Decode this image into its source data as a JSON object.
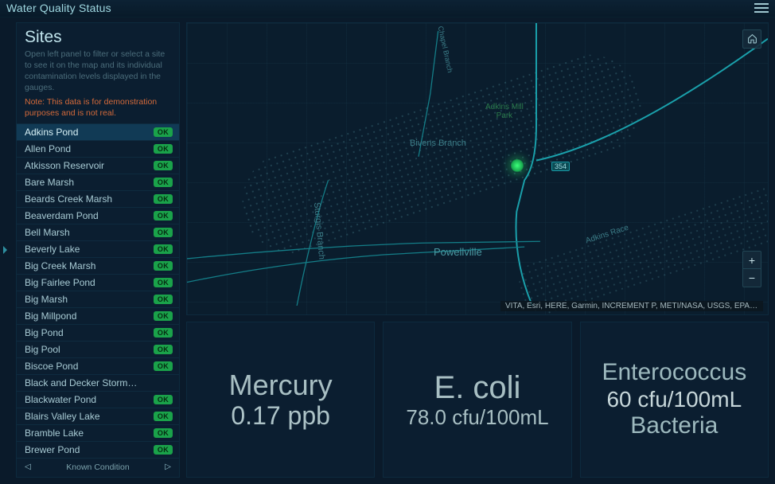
{
  "header": {
    "title": "Water Quality Status"
  },
  "sidebar": {
    "title": "Sites",
    "desc": "Open left panel to filter or select a site to see it on the map and its individual contamination levels displayed in the gauges.",
    "warn": "Note: This data is for demonstration purposes and is not real.",
    "pager_label": "Known Condition",
    "items": [
      {
        "label": "Adkins Pond",
        "status": "OK",
        "selected": true
      },
      {
        "label": "Allen Pond",
        "status": "OK"
      },
      {
        "label": "Atkisson Reservoir",
        "status": "OK"
      },
      {
        "label": "Bare Marsh",
        "status": "OK"
      },
      {
        "label": "Beards Creek Marsh",
        "status": "OK"
      },
      {
        "label": "Beaverdam Pond",
        "status": "OK"
      },
      {
        "label": "Bell Marsh",
        "status": "OK"
      },
      {
        "label": "Beverly Lake",
        "status": "OK"
      },
      {
        "label": "Big Creek Marsh",
        "status": "OK"
      },
      {
        "label": "Big Fairlee Pond",
        "status": "OK"
      },
      {
        "label": "Big Marsh",
        "status": "OK"
      },
      {
        "label": "Big Millpond",
        "status": "OK"
      },
      {
        "label": "Big Pond",
        "status": "OK"
      },
      {
        "label": "Big Pool",
        "status": "OK"
      },
      {
        "label": "Biscoe Pond",
        "status": "OK"
      },
      {
        "label": "Black and Decker Stormwater Pond",
        "status": ""
      },
      {
        "label": "Blackwater Pond",
        "status": "OK"
      },
      {
        "label": "Blairs Valley Lake",
        "status": "OK"
      },
      {
        "label": "Bramble Lake",
        "status": "OK"
      },
      {
        "label": "Brewer Pond",
        "status": "OK"
      }
    ]
  },
  "map": {
    "city_label": "Powellville",
    "park_label_l1": "Adkins Mill",
    "park_label_l2": "Park",
    "branch1": "Bivens Branch",
    "branch2": "Sturgis Branch",
    "chapel": "Chapel Branch",
    "race": "Adkins Race",
    "hwy": "354",
    "attribution": "VITA, Esri, HERE, Garmin, INCREMENT P, METI/NASA, USGS, EPA, NPS,…"
  },
  "cards": {
    "mercury": {
      "title": "Mercury",
      "value": "0.17 ppb"
    },
    "ecoli": {
      "title": "E. coli",
      "value": "78.0 cfu/100mL"
    },
    "entero": {
      "title": "Enterococcus",
      "value": "60 cfu/100mL",
      "sub": "Bacteria"
    }
  }
}
